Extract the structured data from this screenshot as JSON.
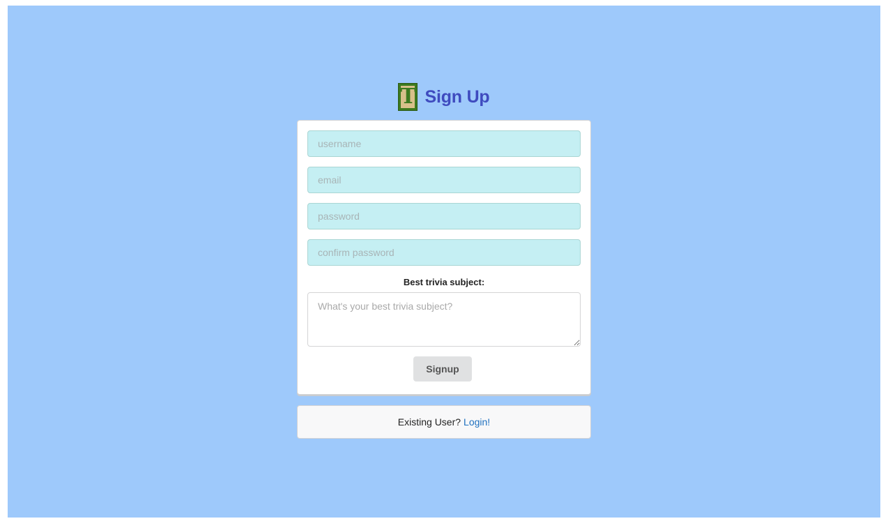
{
  "header": {
    "logo_letter": "T",
    "title": "Sign Up"
  },
  "form": {
    "username_placeholder": "username",
    "email_placeholder": "email",
    "password_placeholder": "password",
    "confirm_placeholder": "confirm password",
    "subject_label": "Best trivia subject:",
    "subject_placeholder": "What's your best trivia subject?",
    "submit_label": "Signup"
  },
  "footer": {
    "prompt": "Existing User?",
    "login_link": "Login!"
  },
  "colors": {
    "background": "#9ec9fb",
    "title": "#3f4bbf",
    "input_fill": "#c5eff3",
    "link": "#1e70bf"
  }
}
